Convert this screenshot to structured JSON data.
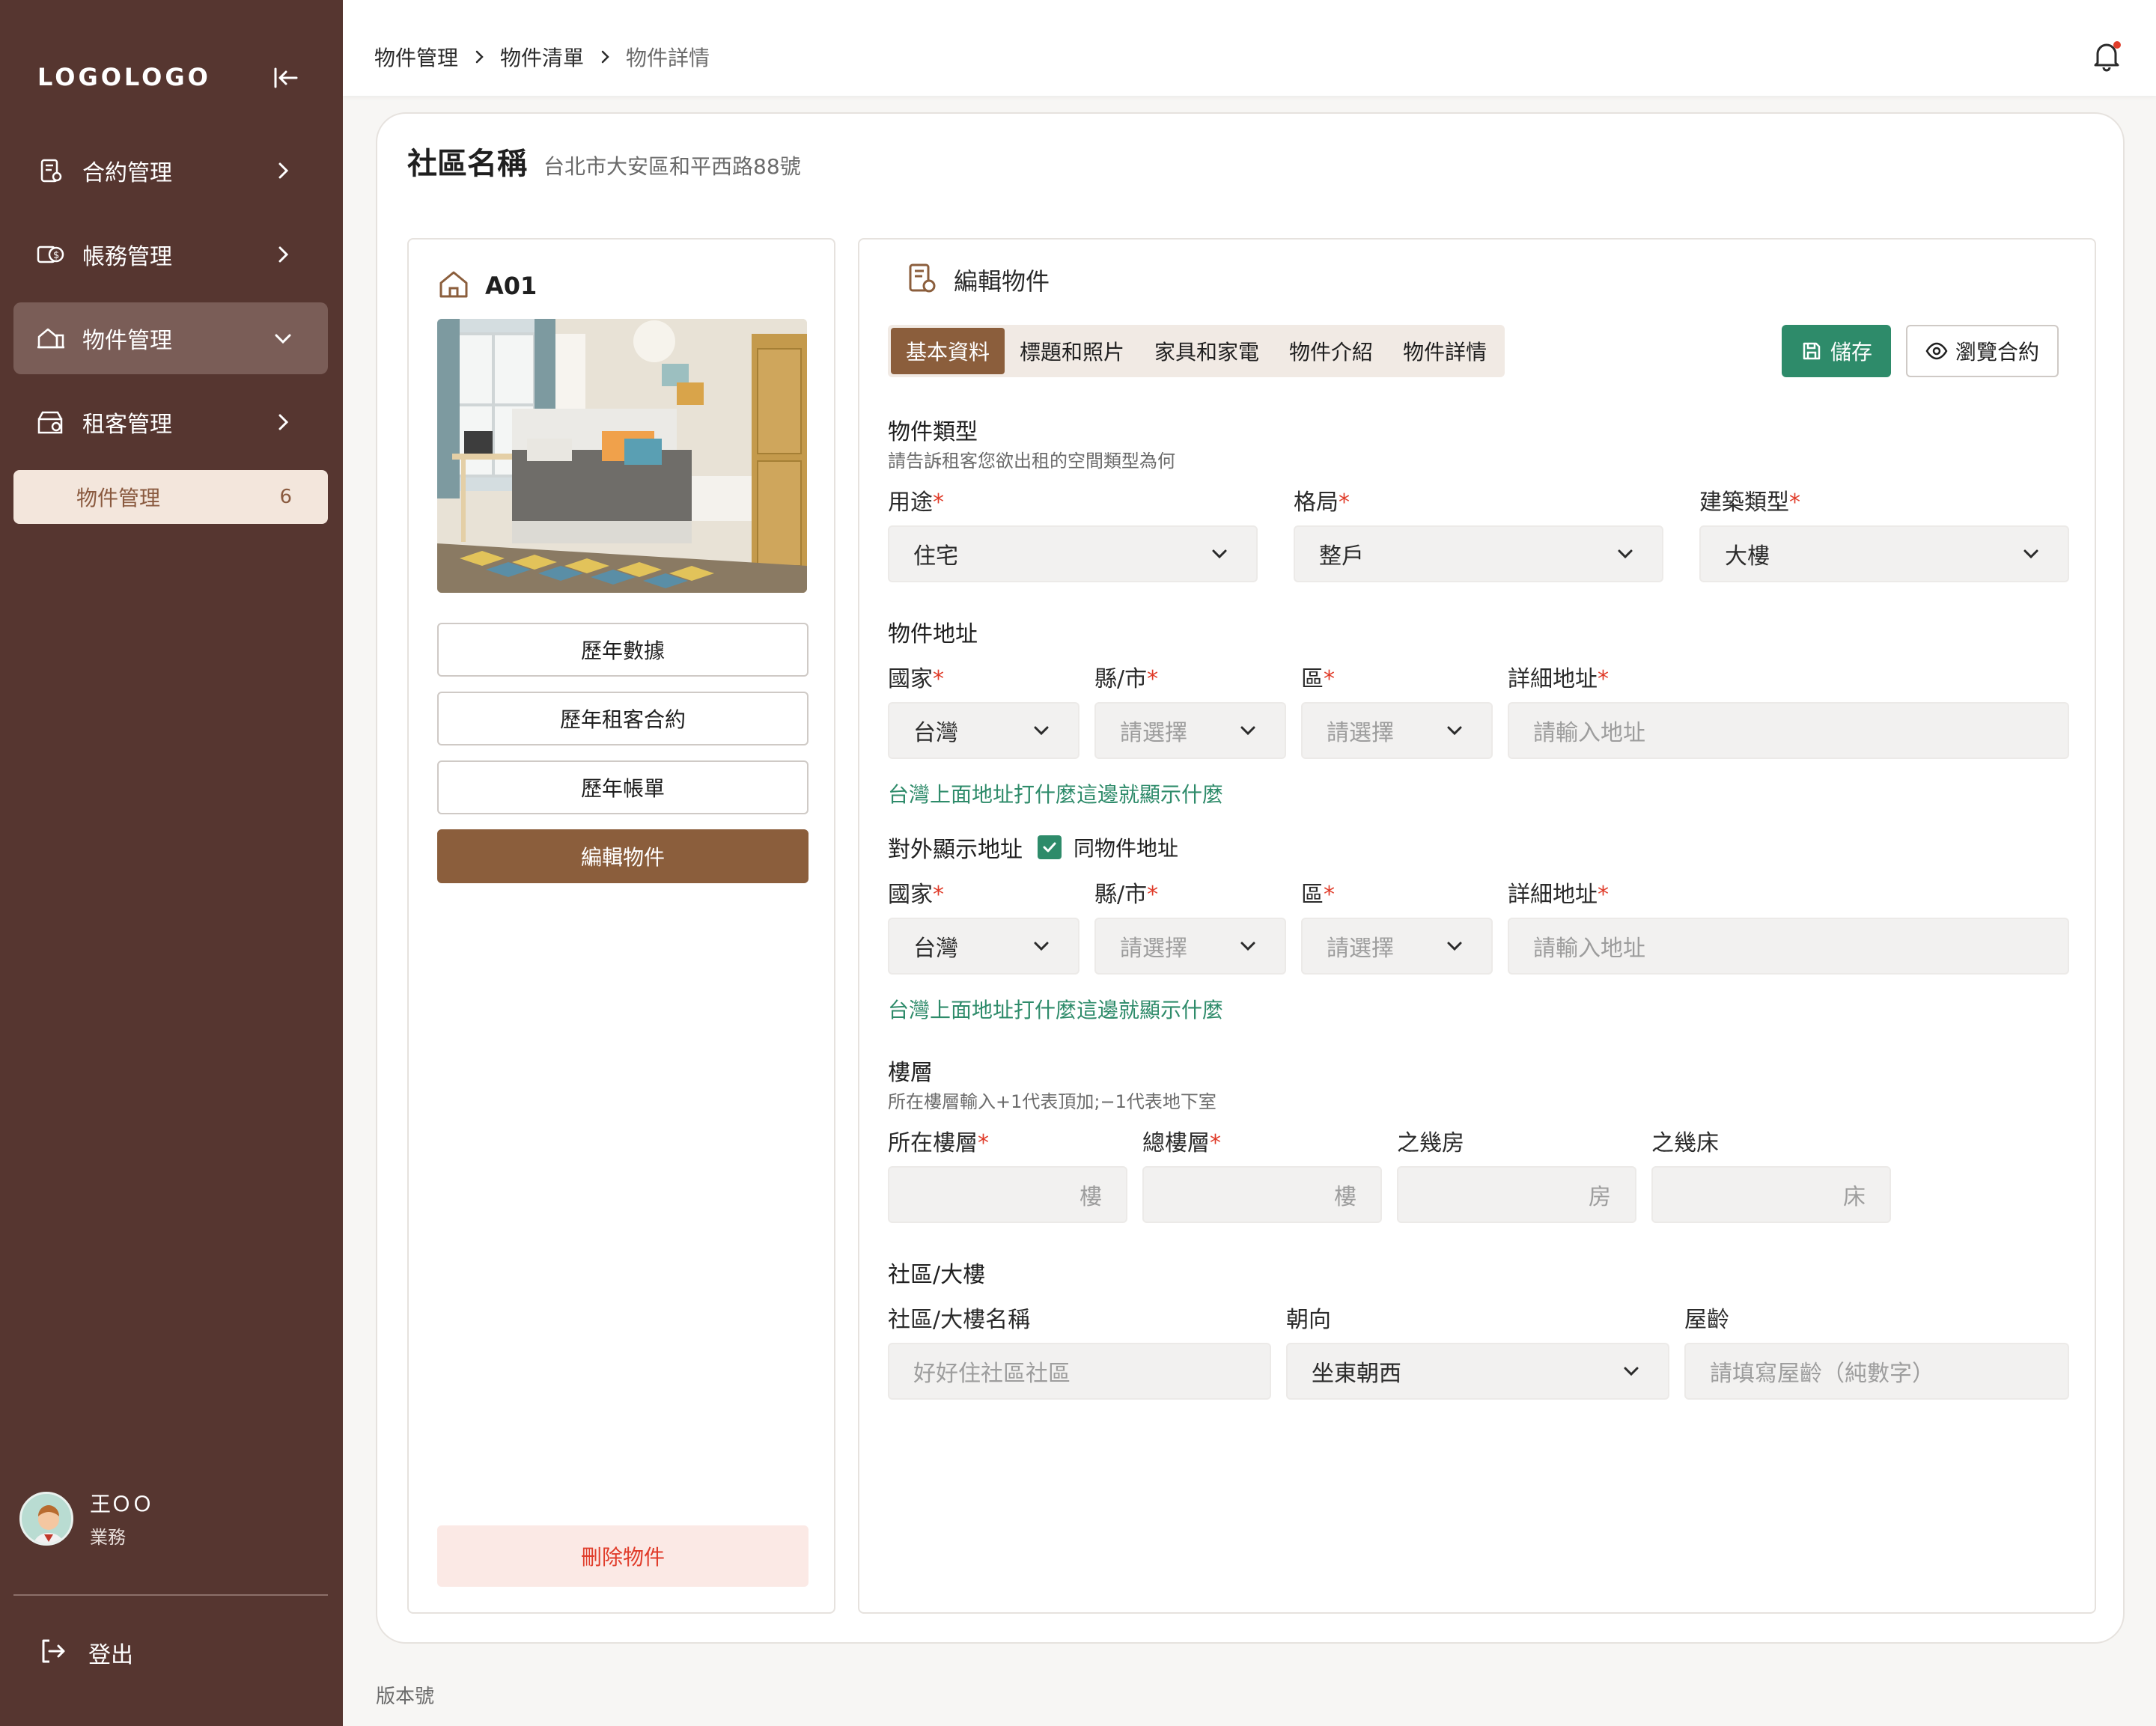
{
  "sidebar": {
    "logo": "LOGOLOGO",
    "items": [
      {
        "label": "合約管理"
      },
      {
        "label": "帳務管理"
      },
      {
        "label": "物件管理"
      },
      {
        "label": "租客管理"
      }
    ],
    "sub_item": {
      "label": "物件管理",
      "count": "6"
    },
    "user": {
      "name": "王ＯＯ",
      "role": "業務"
    },
    "logout_label": "登出"
  },
  "breadcrumb": [
    "物件管理",
    "物件清單",
    "物件詳情"
  ],
  "page": {
    "title": "社區名稱",
    "subtitle": "台北市大安區和平西路88號"
  },
  "left_panel": {
    "unit": "A01",
    "buttons": [
      "歷年數據",
      "歷年租客合約",
      "歷年帳單",
      "編輯物件"
    ],
    "delete_label": "刪除物件"
  },
  "editor": {
    "title": "編輯物件",
    "tabs": [
      "基本資料",
      "標題和照片",
      "家具和家電",
      "物件介紹",
      "物件詳情"
    ],
    "save_label": "儲存",
    "preview_label": "瀏覽合約",
    "type_section": {
      "title": "物件類型",
      "desc": "請告訴租客您欲出租的空間類型為何",
      "fields": [
        {
          "label": "用途",
          "value": "住宅"
        },
        {
          "label": "格局",
          "value": "整戶"
        },
        {
          "label": "建築類型",
          "value": "大樓"
        }
      ]
    },
    "address_section": {
      "title": "物件地址",
      "country_label": "國家",
      "city_label": "縣/市",
      "district_label": "區",
      "detail_label": "詳細地址",
      "country_value": "台灣",
      "select_placeholder": "請選擇",
      "address_placeholder": "請輸入地址",
      "hint": "台灣上面地址打什麼這邊就顯示什麼"
    },
    "public_address": {
      "title": "對外顯示地址",
      "same_label": "同物件地址",
      "country_label": "國家",
      "city_label": "縣/市",
      "district_label": "區",
      "detail_label": "詳細地址",
      "country_value": "台灣",
      "select_placeholder": "請選擇",
      "address_placeholder": "請輸入地址",
      "hint": "台灣上面地址打什麼這邊就顯示什麼"
    },
    "floor_section": {
      "title": "樓層",
      "desc": "所在樓層輸入+1代表頂加;−1代表地下室",
      "fields": [
        {
          "label": "所在樓層",
          "suffix": "樓"
        },
        {
          "label": "總樓層",
          "suffix": "樓"
        },
        {
          "label": "之幾房",
          "suffix": "房"
        },
        {
          "label": "之幾床",
          "suffix": "床"
        }
      ]
    },
    "building_section": {
      "title": "社區/大樓",
      "name_label": "社區/大樓名稱",
      "name_placeholder": "好好住社區社區",
      "orientation_label": "朝向",
      "orientation_value": "坐東朝西",
      "age_label": "屋齡",
      "age_placeholder": "請填寫屋齡（純數字）"
    }
  },
  "footer": "版本號",
  "colors": {
    "sidebar": "#563630",
    "accent": "#8b5e3c",
    "success": "#2e8b6a",
    "danger": "#e03c2a"
  }
}
